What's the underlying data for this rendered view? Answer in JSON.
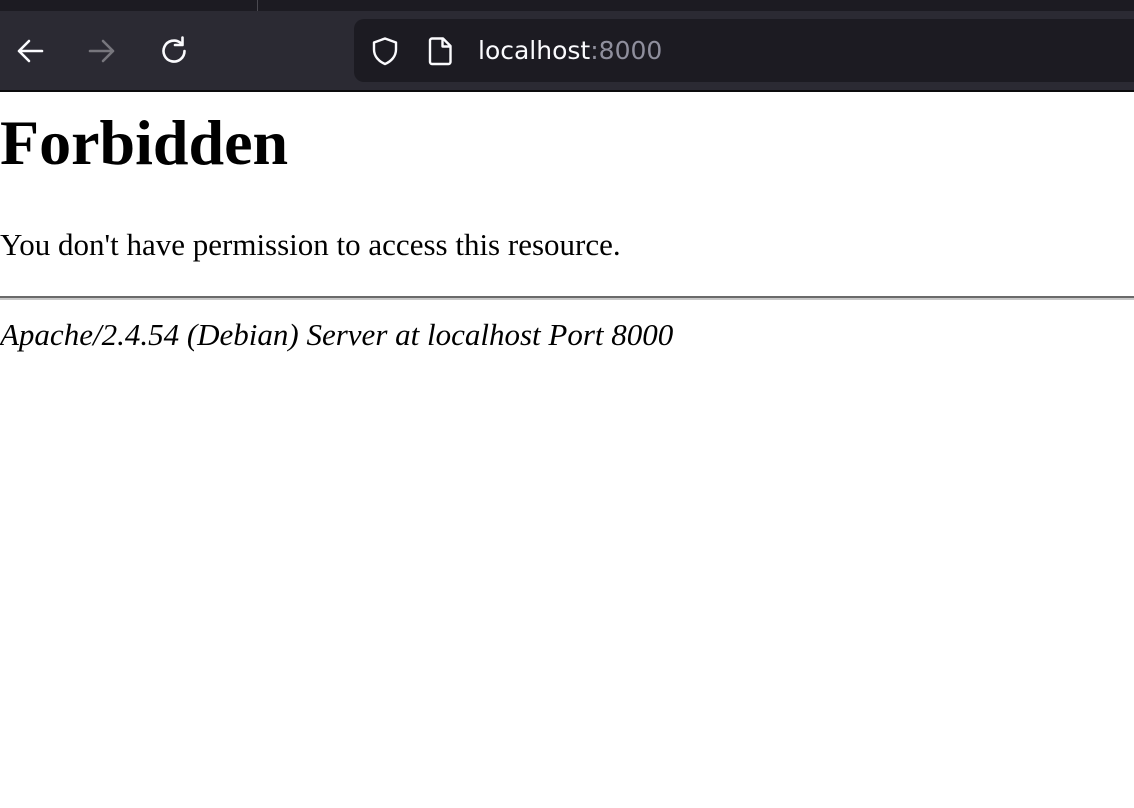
{
  "browser": {
    "icons": {
      "back": "arrow-left-icon",
      "forward": "arrow-right-icon",
      "reload": "reload-icon",
      "tracking": "shield-icon",
      "page": "page-icon"
    },
    "forward_disabled": true,
    "url": {
      "host": "localhost",
      "port": ":8000"
    },
    "colors": {
      "toolbar": "#2b2a33",
      "urlbar": "#1c1b22",
      "url_text": "#fbfbfe",
      "url_dim": "#8f8f9d"
    }
  },
  "page": {
    "title": "Forbidden",
    "message": "You don't have permission to access this resource.",
    "server_signature": "Apache/2.4.54 (Debian) Server at localhost Port 8000"
  }
}
